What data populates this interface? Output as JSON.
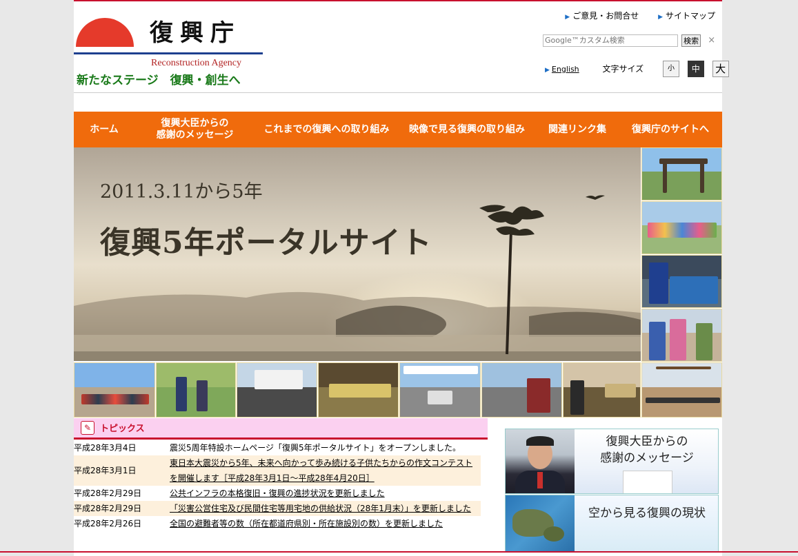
{
  "header": {
    "logo_title": "復興庁",
    "logo_subtitle": "Reconstruction Agency",
    "catchphrase": "新たなステージ　復興・創生へ",
    "links": [
      {
        "label": "ご意見・お問合せ"
      },
      {
        "label": "サイトマップ"
      }
    ],
    "search": {
      "placeholder": "Google™カスタム検索",
      "button": "検索",
      "clear": "×"
    },
    "english_link": "English",
    "fontsize": {
      "label": "文字サイズ",
      "small": "小",
      "medium": "中",
      "large": "大",
      "selected": "中"
    }
  },
  "nav": [
    {
      "label": "ホーム"
    },
    {
      "label": "復興大臣からの\n感謝のメッセージ"
    },
    {
      "label": "これまでの復興への取り組み"
    },
    {
      "label": "映像で見る復興の取り組み"
    },
    {
      "label": "関連リンク集"
    },
    {
      "label": "復興庁のサイトへ"
    }
  ],
  "hero": {
    "line1": "2011.3.11から5年",
    "line2": "復興5年ポータルサイト"
  },
  "topics": {
    "title": "トピックス",
    "items": [
      {
        "date": "平成28年3月4日",
        "title": "震災5周年特設ホームページ「復興5年ポータルサイト」をオープンしました。",
        "link": false
      },
      {
        "date": "平成28年3月1日",
        "title": "東日本大震災から5年、未来へ向かって歩み続ける子供たちからの作文コンテストを開催します［平成28年3月1日〜平成28年4月20日］",
        "link": true
      },
      {
        "date": "平成28年2月29日",
        "title": "公共インフラの本格復旧・復興の進捗状況を更新しました",
        "link": true
      },
      {
        "date": "平成28年2月29日",
        "title": "「災害公営住宅及び民間住宅等用宅地の供給状況（28年1月末）」を更新しました",
        "link": true
      },
      {
        "date": "平成28年2月26日",
        "title": "全国の避難者等の数（所在都道府県別・所在施設別の数）を更新しました",
        "link": true
      }
    ]
  },
  "banners": {
    "minister": "復興大臣からの\n感謝のメッセージ",
    "aerial": "空から見る復興の現状"
  },
  "colors": {
    "accent_red": "#c8102e",
    "nav_orange": "#f06b0c",
    "catch_green": "#1a7a1a",
    "topics_pink": "#fbd0f0"
  }
}
